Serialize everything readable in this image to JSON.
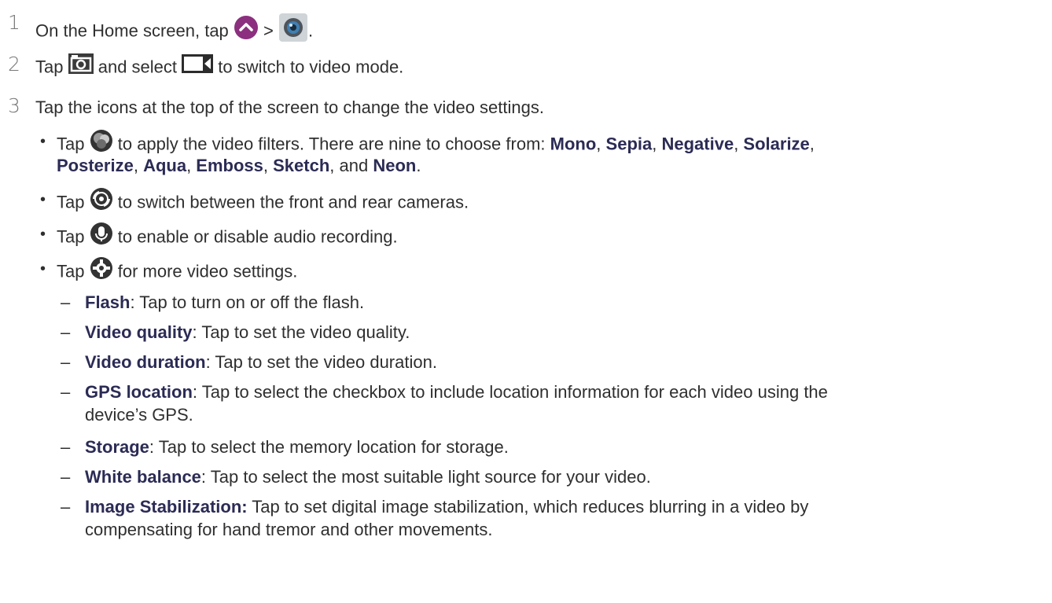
{
  "steps": [
    {
      "num": "1",
      "pre": "On the Home screen, tap",
      "mid": ">",
      "post": "."
    },
    {
      "num": "2",
      "pre": "Tap",
      "mid": "and select",
      "post": "to switch to video mode."
    },
    {
      "num": "3",
      "text": "Tap the icons at the top of the screen to change the video settings."
    }
  ],
  "bullets": {
    "filters": {
      "pre": "Tap",
      "post": "to apply the video filters. There are nine to choose from:",
      "f1": "Mono",
      "f2": "Sepia",
      "f3": "Negative",
      "f4": "Solarize",
      "f5": "Posterize",
      "f6": "Aqua",
      "f7": "Emboss",
      "f8": "Sketch",
      "and": "and",
      "f9": "Neon"
    },
    "switch": {
      "pre": "Tap",
      "post": "to switch between the front and rear cameras."
    },
    "audio": {
      "pre": "Tap",
      "post": "to enable or disable audio recording."
    },
    "settings": {
      "pre": "Tap",
      "post": "for more video settings."
    }
  },
  "settings": [
    {
      "term": "Flash",
      "desc": ": Tap to turn on or off the flash."
    },
    {
      "term": "Video quality",
      "desc": ": Tap to set the video quality."
    },
    {
      "term": "Video duration",
      "desc": ": Tap to set the video duration."
    },
    {
      "term": "GPS location",
      "desc": ": Tap to select the checkbox to include location information for each video using the",
      "desc2": "device’s GPS."
    },
    {
      "term": "Storage",
      "desc": ": Tap to select the memory location for storage."
    },
    {
      "term": "White balance",
      "desc": ": Tap to select the most suitable light source for your video."
    },
    {
      "term": "Image Stabilization:",
      "desc": " Tap to set digital image stabilization, which reduces blurring in a video by",
      "desc2": "compensating for hand tremor and other movements."
    }
  ],
  "colors": {
    "apps_button": "#8c2f7e",
    "term_text": "#2b2b55",
    "body_text": "#2f2f2f"
  },
  "icons": [
    "apps-chevron-icon",
    "camera-app-icon",
    "camera-mode-icon",
    "video-mode-icon",
    "filter-icon",
    "switch-camera-icon",
    "microphone-icon",
    "settings-gear-icon"
  ]
}
